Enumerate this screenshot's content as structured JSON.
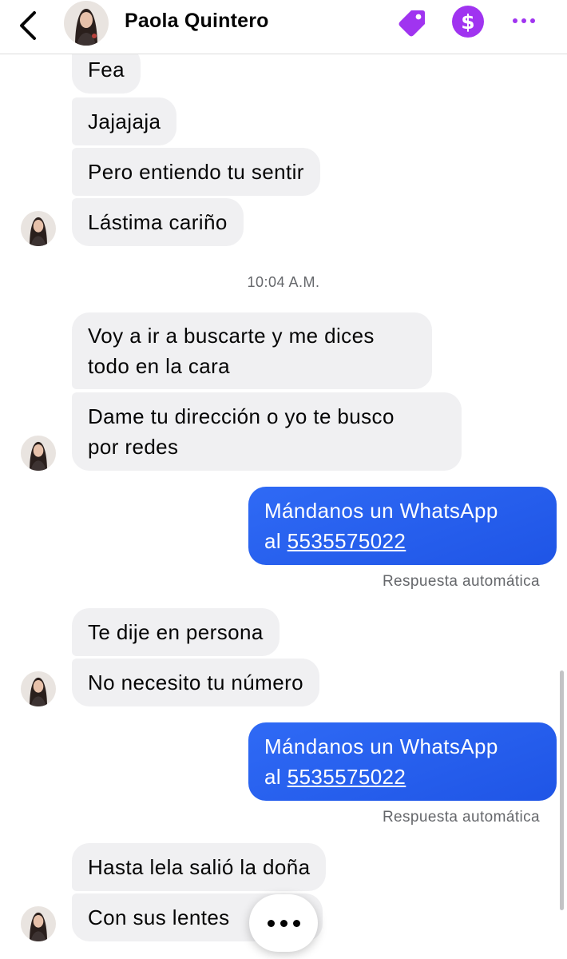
{
  "header": {
    "contact_name": "Paola Quintero",
    "dollar_symbol": "$"
  },
  "messages": {
    "m1": "Fea",
    "m2": "Jajajaja",
    "m3": "Pero entiendo tu sentir",
    "m4": "Lástima cariño",
    "time1": "10:04 A.M.",
    "m5_line1": "Voy a ir a buscarte y me dices",
    "m5_line2": "todo en la cara",
    "m6_line1": "Dame tu dirección o yo te busco",
    "m6_line2": "por redes",
    "out1_line1": "Mándanos un WhatsApp",
    "out1_prefix": "al",
    "out1_phone": "5535575022",
    "auto1": "Respuesta automática",
    "m7": "Te dije en persona",
    "m8": "No necesito tu número",
    "out2_line1": "Mándanos un WhatsApp",
    "out2_prefix": "al",
    "out2_phone": "5535575022",
    "auto2": "Respuesta automática",
    "m9": "Hasta lela salió la doña",
    "m10": "Con sus lentes"
  },
  "colors": {
    "accent": "#a034f0",
    "outgoing_bubble": "#2563eb",
    "incoming_bubble": "#f0f0f2"
  },
  "icons": [
    "back-chevron-icon",
    "tag-icon",
    "dollar-icon",
    "more-icon",
    "typing-indicator-icon"
  ]
}
